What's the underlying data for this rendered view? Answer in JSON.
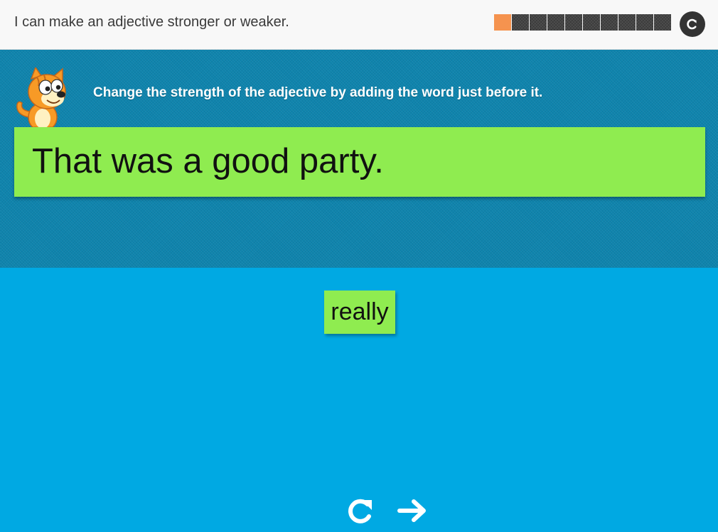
{
  "header": {
    "objective": "I can make an adjective stronger or weaker.",
    "progress": {
      "total": 10,
      "completed": 1,
      "done_color": "#f5934f",
      "todo_color": "#3b3b3b"
    },
    "restart_icon": "restart-icon"
  },
  "question": {
    "mascot_icon": "cat-mascot-icon",
    "instruction": "Change the strength of the adjective by adding the word just before it.",
    "sentence": "That was a good party."
  },
  "answer": {
    "word_tiles": [
      "really"
    ]
  },
  "controls": {
    "retry_icon": "retry-icon",
    "next_icon": "next-arrow-icon"
  },
  "colors": {
    "question_bg": "#0f84ad",
    "answer_bg": "#00a9e3",
    "tile_green": "#8fec50",
    "header_bg": "#f8f8f8"
  }
}
